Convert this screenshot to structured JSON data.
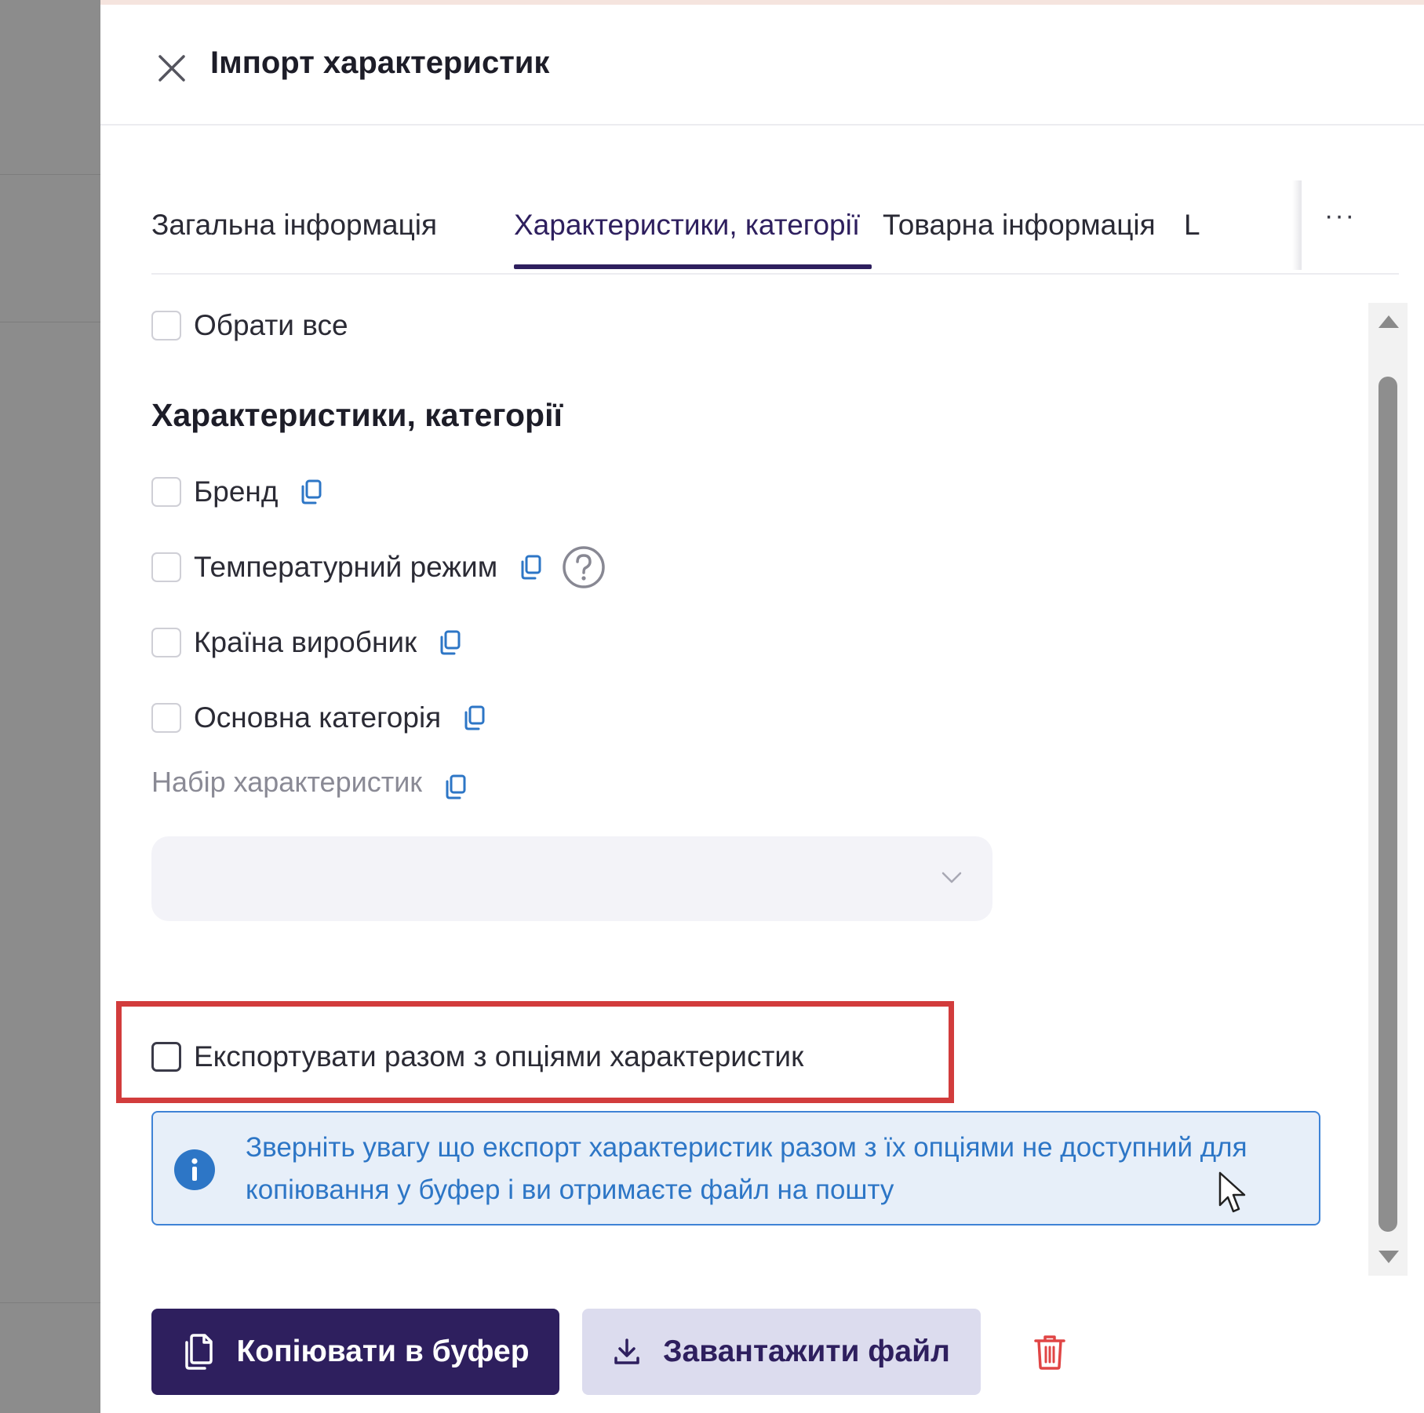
{
  "dialog": {
    "title": "Імпорт характеристик"
  },
  "tabs": [
    {
      "label": "Загальна інформація",
      "active": false
    },
    {
      "label": "Характеристики, категорії",
      "active": true
    },
    {
      "label": "Товарна інформація",
      "active": false
    },
    {
      "label": "L",
      "active": false
    }
  ],
  "tabs_more": "···",
  "select_all": {
    "label": "Обрати все",
    "checked": false
  },
  "section": {
    "title": "Характеристики, категорії",
    "items": [
      {
        "label": "Бренд",
        "checked": false
      },
      {
        "label": "Температурний режим",
        "checked": false,
        "help": true
      },
      {
        "label": "Країна виробник",
        "checked": false
      },
      {
        "label": "Основна категорія",
        "checked": false
      }
    ],
    "set_label": "Набір характеристик",
    "set_value": ""
  },
  "export_with_options": {
    "label": "Експортувати разом з опціями характеристик",
    "checked": false
  },
  "info": {
    "text": "Зверніть увагу що експорт характеристик разом з їх опціями не доступний для копіювання у буфер і ви отримаєте файл на пошту"
  },
  "actions": {
    "copy_label": "Копіювати в буфер",
    "download_label": "Завантажити файл"
  },
  "colors": {
    "primary": "#2e1f5e",
    "secondary_bg": "#dcdcee",
    "info_text": "#2d76c6",
    "info_bg": "#e7eff9",
    "highlight": "#d23c3c",
    "danger": "#e04545",
    "copy_icon": "#2d76c6"
  },
  "icons": [
    "close-icon",
    "copy-icon",
    "help-icon",
    "chevron-down-icon",
    "info-icon",
    "clipboard-icon",
    "download-icon",
    "trash-icon",
    "mouse-cursor-icon"
  ]
}
